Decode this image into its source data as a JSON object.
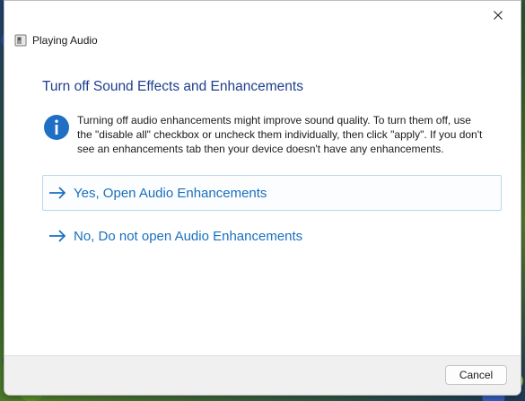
{
  "window": {
    "title": "Playing Audio",
    "app_icon": "speaker-troubleshooter-icon",
    "close_icon": "close-icon"
  },
  "main_instruction": "Turn off Sound Effects and Enhancements",
  "content": {
    "icon": "info-icon",
    "text": "Turning off audio enhancements might improve sound quality. To turn them off, use the \"disable all\" checkbox or uncheck them individually, then click \"apply\". If you don't see an enhancements tab then your device doesn't have any enhancements."
  },
  "command_links": [
    {
      "label": "Yes, Open Audio Enhancements",
      "icon": "arrow-right-icon",
      "focused": true
    },
    {
      "label": "No, Do not open Audio Enhancements",
      "icon": "arrow-right-icon",
      "focused": false
    }
  ],
  "footer": {
    "cancel_label": "Cancel"
  },
  "colors": {
    "instruction": "#1e3f8c",
    "link": "#1b6fbd",
    "info_icon": "#1f6fc5",
    "footer_bg": "#f0f0f0"
  }
}
